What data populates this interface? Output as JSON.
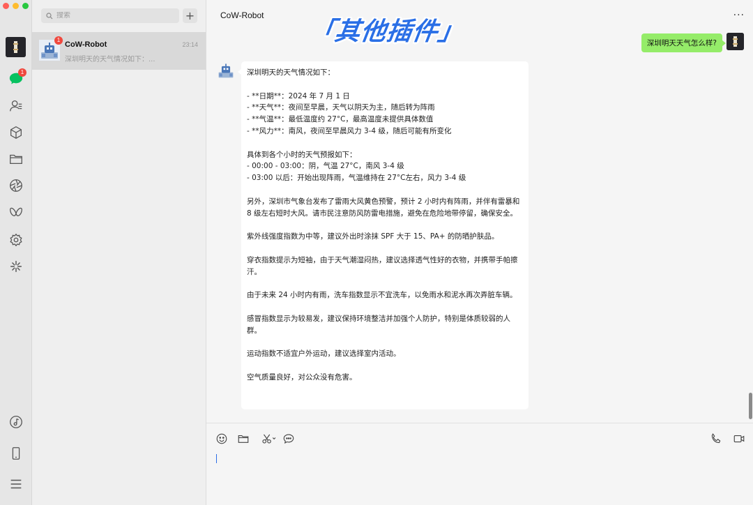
{
  "window": {
    "traffic_colors": [
      "#ff5f57",
      "#febc2e",
      "#28c840"
    ]
  },
  "rail": {
    "chat_badge": "1",
    "icons": [
      "chat-icon",
      "contacts-icon",
      "cube-icon",
      "folder-icon",
      "aperture-icon",
      "butterfly-icon",
      "settings-gear-icon",
      "sparkle-icon",
      "music-note-icon",
      "phone-device-icon",
      "menu-icon"
    ]
  },
  "sidebar": {
    "search_placeholder": "搜索",
    "add_label": "+",
    "conversations": [
      {
        "name": "CoW-Robot",
        "time": "23:14",
        "preview": "深圳明天的天气情况如下：...",
        "badge": "1"
      }
    ]
  },
  "chat": {
    "title": "CoW-Robot",
    "more": "···",
    "watermark": "「其他插件」",
    "user_message": "深圳明天天气怎么样?",
    "bot_message": "深圳明天的天气情况如下：\n\n- **日期**：2024 年 7 月 1 日\n- **天气**：夜间至早晨，天气以阴天为主，随后转为阵雨\n- **气温**：最低温度约 27°C，最高温度未提供具体数值\n- **风力**：南风，夜间至早晨风力 3-4 级，随后可能有所变化\n\n具体到各个小时的天气预报如下：\n- 00:00 - 03:00：阴，气温 27°C，南风 3-4 级\n- 03:00 以后：开始出现阵雨，气温维持在 27°C左右，风力 3-4 级\n\n另外，深圳市气象台发布了雷雨大风黄色预警，预计 2 小时内有阵雨，并伴有雷暴和 8 级左右短时大风。请市民注意防风防雷电措施，避免在危险地带停留，确保安全。\n\n紫外线强度指数为中等，建议外出时涂抹 SPF 大于 15、PA+ 的防晒护肤品。\n\n穿衣指数提示为短袖，由于天气潮湿闷热，建议选择透气性好的衣物，并携带手帕擦汗。\n\n由于未来 24 小时内有雨，洗车指数显示不宜洗车，以免雨水和泥水再次弄脏车辆。\n\n感冒指数显示为较易发，建议保持环境整洁并加强个人防护，特别是体质较弱的人群。\n\n运动指数不适宜户外运动，建议选择室内活动。\n\n空气质量良好，对公众没有危害。",
    "composer_value": ""
  },
  "colors": {
    "user_bubble": "#95ec69",
    "badge": "#f0483e",
    "watermark": "#2a6fe6"
  }
}
